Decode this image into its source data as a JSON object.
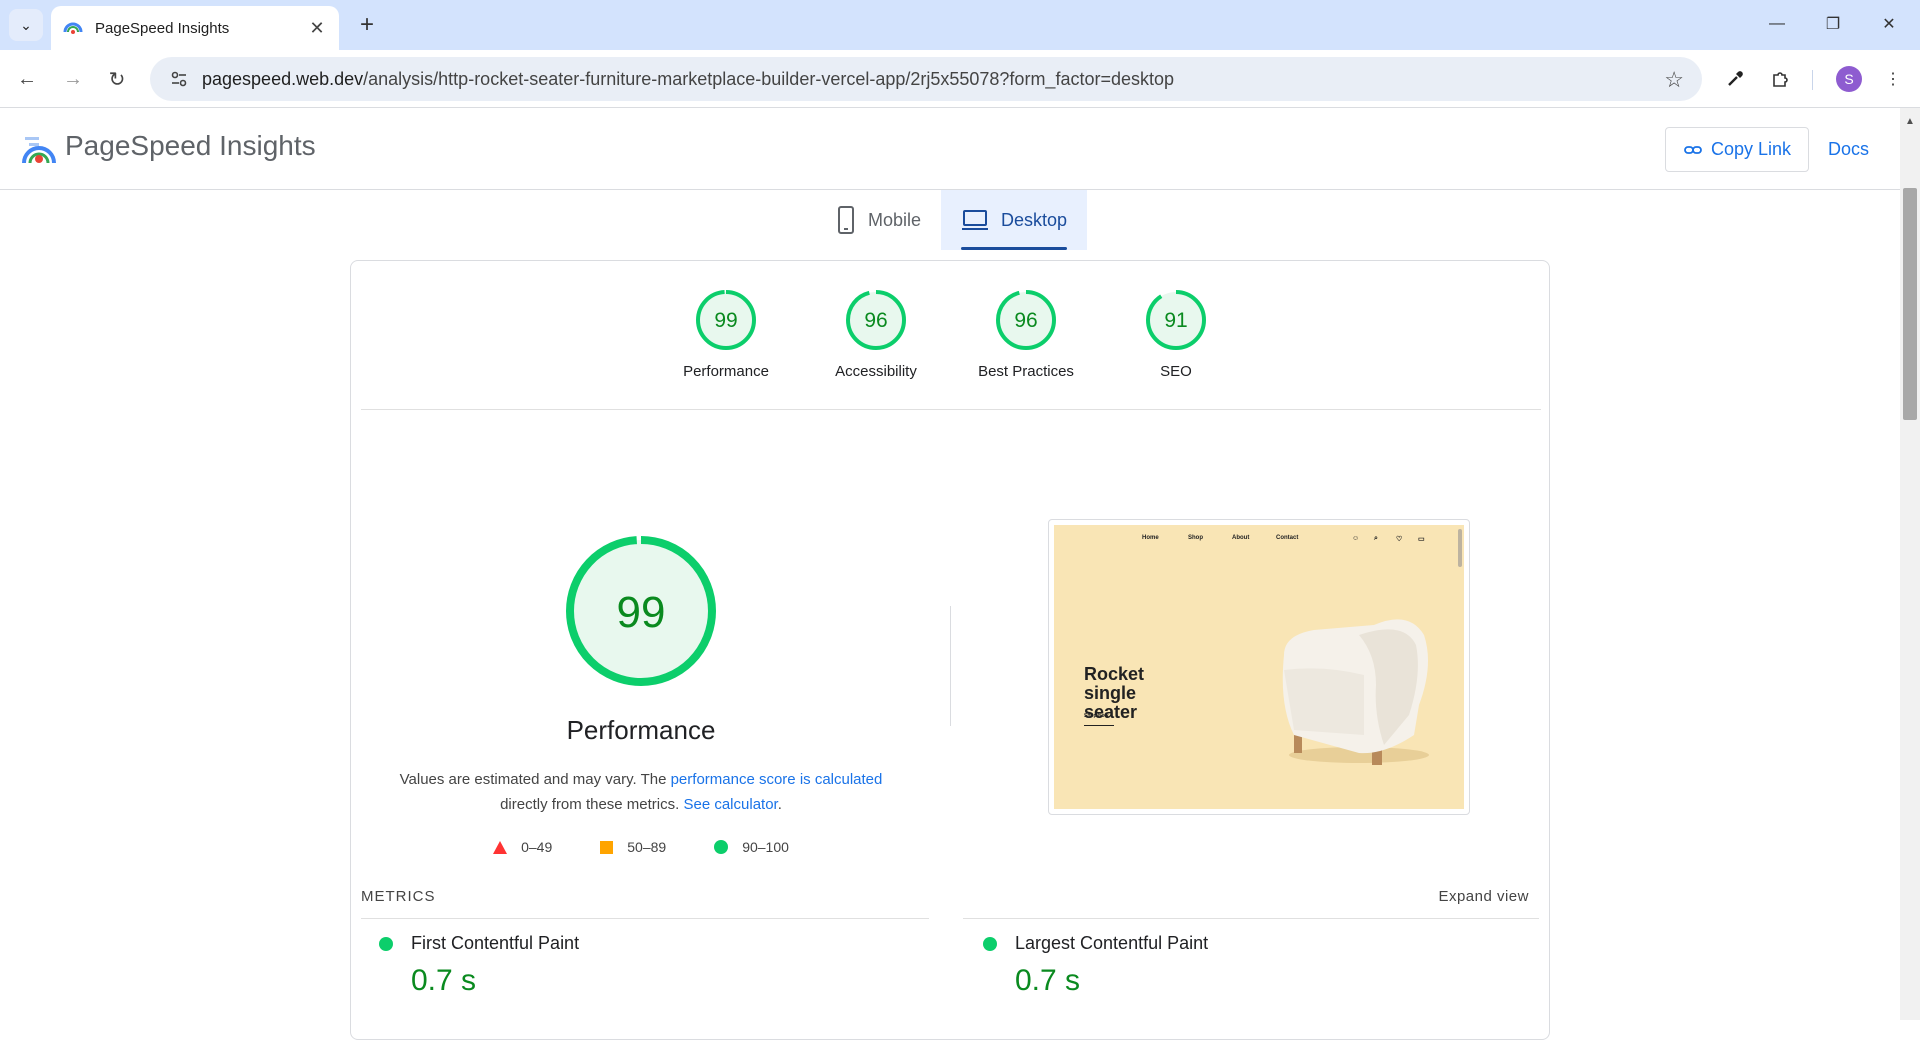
{
  "browser": {
    "tab_title": "PageSpeed Insights",
    "url_host": "pagespeed.web.dev",
    "url_path": "/analysis/http-rocket-seater-furniture-marketplace-builder-vercel-app/2rj5x55078?form_factor=desktop",
    "avatar_letter": "S"
  },
  "app": {
    "brand": "PageSpeed Insights",
    "copy_link": "Copy Link",
    "docs": "Docs"
  },
  "device_tabs": [
    {
      "label": "Mobile",
      "active": false
    },
    {
      "label": "Desktop",
      "active": true
    }
  ],
  "scores": [
    {
      "value": 99,
      "label": "Performance"
    },
    {
      "value": 96,
      "label": "Accessibility"
    },
    {
      "value": 96,
      "label": "Best Practices"
    },
    {
      "value": 91,
      "label": "SEO"
    }
  ],
  "performance": {
    "score": "99",
    "title": "Performance",
    "desc_1": "Values are estimated and may vary. The ",
    "desc_link_1": "performance score is calculated",
    "desc_2": "directly from these metrics. ",
    "desc_link_2": "See calculator",
    "desc_3": "."
  },
  "legend": [
    {
      "label": "0–49",
      "color": "#f33"
    },
    {
      "label": "50–89",
      "color": "#ffa400"
    },
    {
      "label": "90–100",
      "color": "#0cce6b"
    }
  ],
  "screenshot": {
    "nav": [
      "Home",
      "Shop",
      "About",
      "Contact"
    ],
    "heading": "Rocket single seater",
    "cta": "Shop Now"
  },
  "metrics": {
    "heading": "METRICS",
    "expand": "Expand view",
    "items": [
      {
        "name": "First Contentful Paint",
        "value": "0.7 s"
      },
      {
        "name": "Largest Contentful Paint",
        "value": "0.7 s"
      }
    ]
  },
  "colors": {
    "pass": "#0cce6b",
    "pass_text": "#0a8a1f",
    "link": "#1a73e8"
  }
}
